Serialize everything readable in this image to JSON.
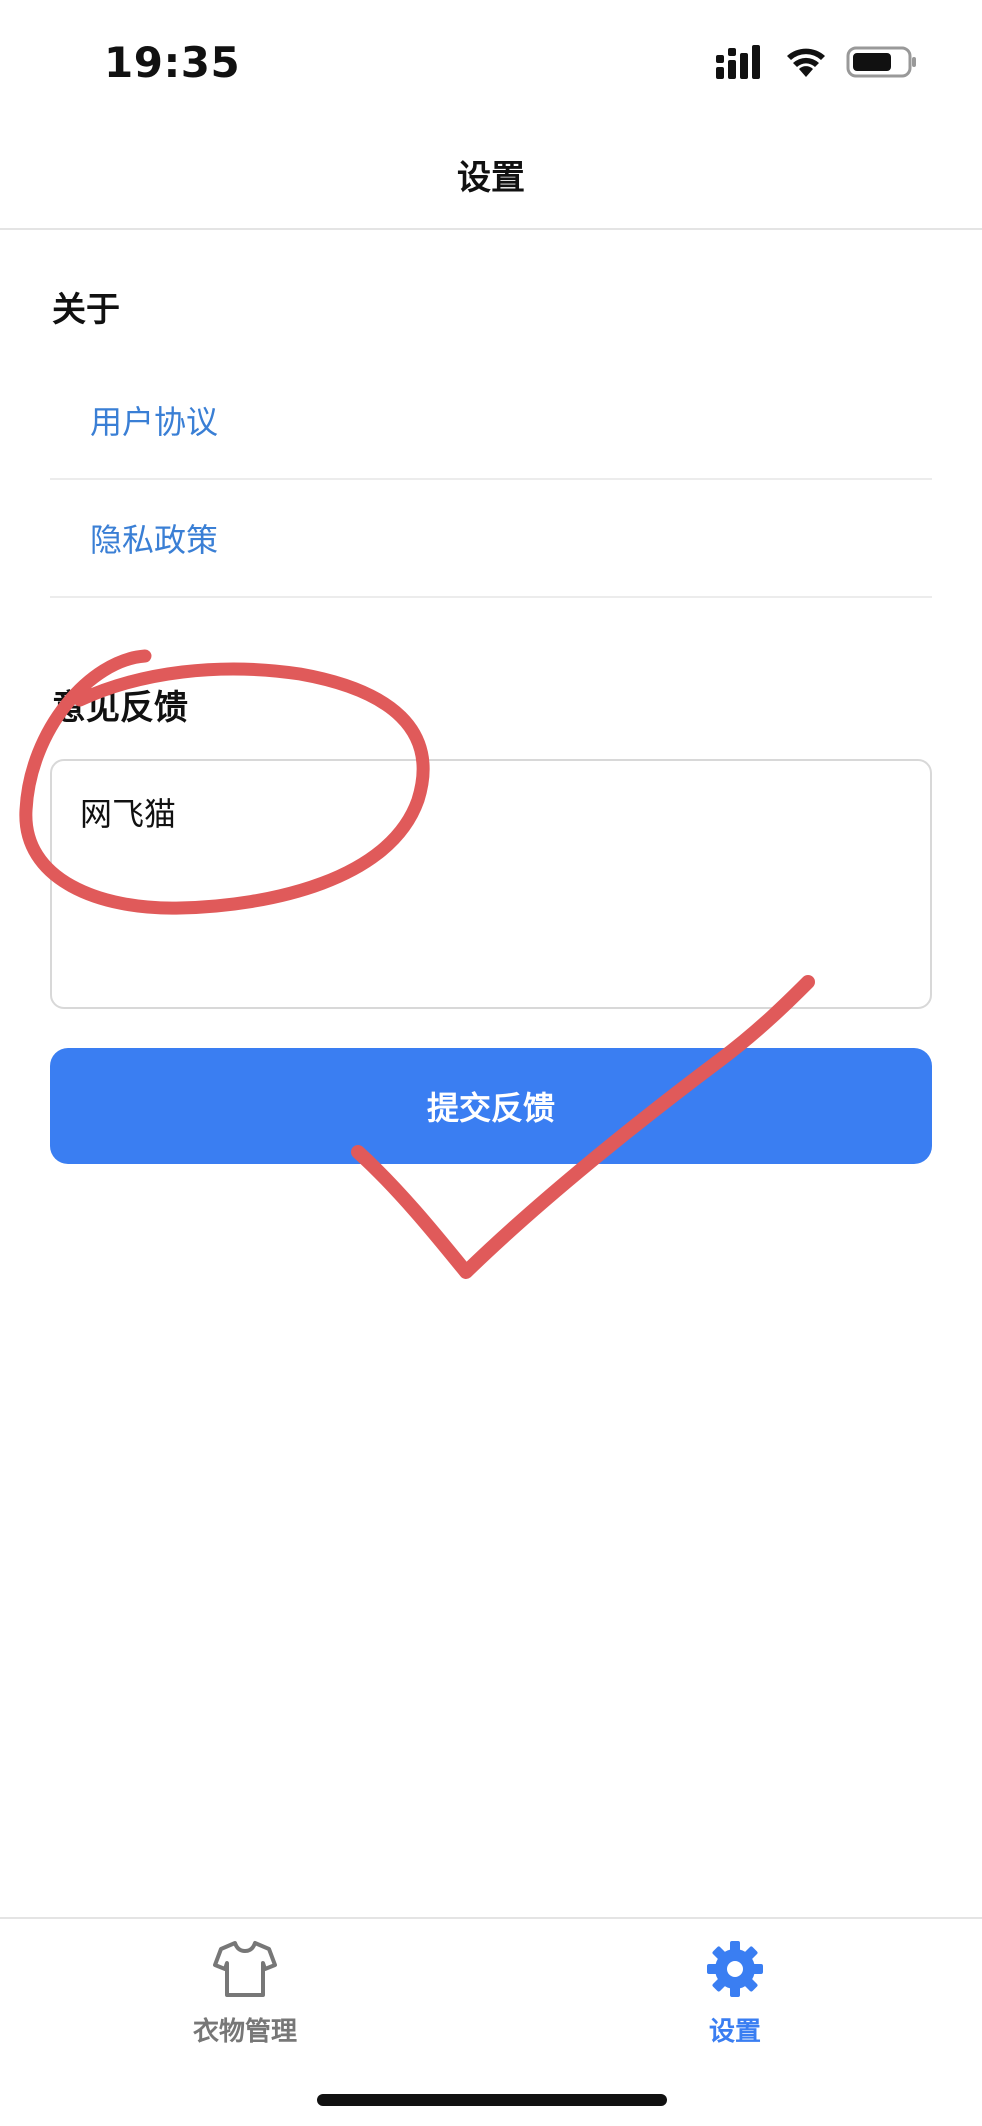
{
  "status_bar": {
    "time": "19:35",
    "icons": [
      "signal-icon",
      "wifi-icon",
      "battery-icon"
    ]
  },
  "nav": {
    "title": "设置"
  },
  "about": {
    "title": "关于",
    "items": [
      {
        "label": "用户协议"
      },
      {
        "label": "隐私政策"
      }
    ]
  },
  "feedback": {
    "title": "意见反馈",
    "value": "网飞猫",
    "submit_label": "提交反馈"
  },
  "tab_bar": {
    "items": [
      {
        "label": "衣物管理",
        "icon": "tshirt-icon",
        "active": false
      },
      {
        "label": "设置",
        "icon": "gear-icon",
        "active": true
      }
    ]
  },
  "colors": {
    "accent": "#3a7ef2",
    "link": "#3a7fd5",
    "annotation": "#e05a5a"
  }
}
